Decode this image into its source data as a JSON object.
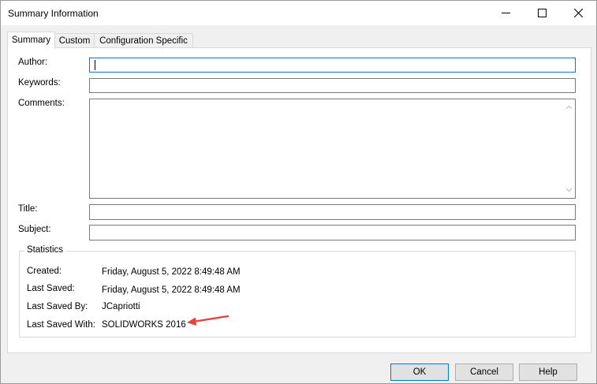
{
  "window": {
    "title": "Summary Information"
  },
  "tabs": [
    {
      "label": "Summary",
      "active": true
    },
    {
      "label": "Custom",
      "active": false
    },
    {
      "label": "Configuration Specific",
      "active": false
    }
  ],
  "fields": {
    "author_label": "Author:",
    "author_value": "",
    "keywords_label": "Keywords:",
    "keywords_value": "",
    "comments_label": "Comments:",
    "comments_value": "",
    "title_label": "Title:",
    "title_value": "",
    "subject_label": "Subject:",
    "subject_value": ""
  },
  "statistics": {
    "legend": "Statistics",
    "created_label": "Created:",
    "created_value": "Friday, August 5, 2022 8:49:48 AM",
    "last_saved_label": "Last Saved:",
    "last_saved_value": "Friday, August 5, 2022 8:49:48 AM",
    "last_saved_by_label": "Last Saved By:",
    "last_saved_by_value": "JCapriotti",
    "last_saved_with_label": "Last Saved With:",
    "last_saved_with_value": "SOLIDWORKS 2016"
  },
  "buttons": {
    "ok": "OK",
    "cancel": "Cancel",
    "help": "Help"
  },
  "colors": {
    "focus_border": "#0078d7",
    "annotation_arrow": "#e8413c"
  }
}
